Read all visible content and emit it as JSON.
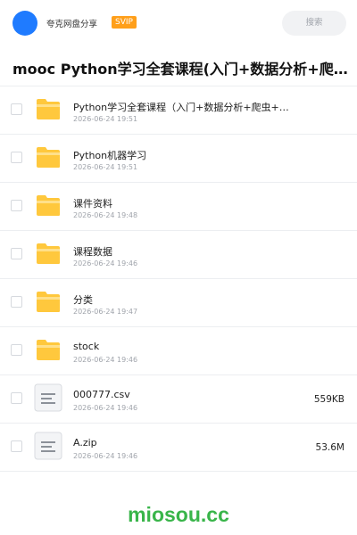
{
  "header": {
    "user_name": "夸克网盘分享",
    "badge": "SVIP",
    "search_placeholder": "搜索"
  },
  "title": "mooc Python学习全套课程(入门+数据分析+爬虫+云端…",
  "files": [
    {
      "name": "Python学习全套课程（入门+数据分析+爬虫+云…",
      "date": "2026-06-24 19:51",
      "type": "folder",
      "size": ""
    },
    {
      "name": "Python机器学习",
      "date": "2026-06-24 19:51",
      "type": "folder",
      "size": ""
    },
    {
      "name": "课件资料",
      "date": "2026-06-24 19:48",
      "type": "folder",
      "size": ""
    },
    {
      "name": "课程数据",
      "date": "2026-06-24 19:46",
      "type": "folder",
      "size": ""
    },
    {
      "name": "分类",
      "date": "2026-06-24 19:47",
      "type": "folder",
      "size": ""
    },
    {
      "name": "stock",
      "date": "2026-06-24 19:46",
      "type": "folder",
      "size": ""
    },
    {
      "name": "000777.csv",
      "date": "2026-06-24 19:46",
      "type": "file",
      "size": "559KB"
    },
    {
      "name": "A.zip",
      "date": "2026-06-24 19:46",
      "type": "file",
      "size": "53.6M"
    }
  ],
  "watermark": "miosou.cc",
  "colors": {
    "accent": "#1f7bff",
    "svip_badge": "#ff9f1a",
    "folder": "#ffc83d",
    "watermark": "#39b54a"
  },
  "icons": {
    "folder": "folder-icon",
    "file": "document-icon"
  }
}
